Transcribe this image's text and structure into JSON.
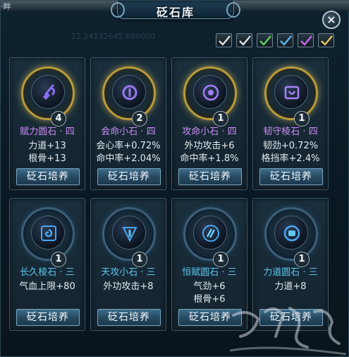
{
  "window": {
    "title": "砭石库",
    "top_left_fragment": "·畔",
    "faint_number": "21.24132645.680000",
    "close_label": "×"
  },
  "filters": [
    {
      "icon": "check-icon",
      "color": "#d8e0e4"
    },
    {
      "icon": "check-icon",
      "color": "#d8e0e4"
    },
    {
      "icon": "check-icon",
      "color": "#5fd35a"
    },
    {
      "icon": "check-icon",
      "color": "#5fb6ef"
    },
    {
      "icon": "check-icon",
      "color": "#c96af0"
    },
    {
      "icon": "check-icon",
      "color": "#e8c860"
    }
  ],
  "colors": {
    "purple_name": "#c98bf2",
    "blue_name": "#5fc6ef",
    "gold_ring": "#b89a3a"
  },
  "stones": [
    {
      "name": "赋力圆石 · 四",
      "count": "4",
      "attrs": [
        "力道+13",
        "根骨+13"
      ],
      "button": "砭石培养",
      "icon": "sword-rune-icon",
      "tier": "purple"
    },
    {
      "name": "会命小石 · 四",
      "count": "2",
      "attrs": [
        "会心率+0.72%",
        "命中率+2.04%"
      ],
      "button": "砭石培养",
      "icon": "circle-rune-icon",
      "tier": "purple"
    },
    {
      "name": "攻命小石 · 四",
      "count": "1",
      "attrs": [
        "外功攻击+6",
        "命中率+1.8%"
      ],
      "button": "砭石培养",
      "icon": "eye-rune-icon",
      "tier": "purple"
    },
    {
      "name": "韧守棱石 · 四",
      "count": "1",
      "attrs": [
        "韧劲+0.72%",
        "格挡率+2.4%"
      ],
      "button": "砭石培养",
      "icon": "shield-rune-icon",
      "tier": "purple"
    },
    {
      "name": "长久棱石 · 三",
      "count": "1",
      "attrs": [
        "气血上限+80",
        ""
      ],
      "button": "砭石培养",
      "icon": "swirl-rune-icon",
      "tier": "blue"
    },
    {
      "name": "天攻小石 · 三",
      "count": "1",
      "attrs": [
        "外功攻击+8",
        ""
      ],
      "button": "砭石培养",
      "icon": "blade-rune-icon",
      "tier": "blue"
    },
    {
      "name": "恒赋圆石 · 三",
      "count": "1",
      "attrs": [
        "气劲+6",
        "根骨+6"
      ],
      "button": "砭石培养",
      "icon": "slash-rune-icon",
      "tier": "blue"
    },
    {
      "name": "力道圆石 · 三",
      "count": "1",
      "attrs": [
        "力道+8",
        ""
      ],
      "button": "砭石培养",
      "icon": "fist-rune-icon",
      "tier": "blue"
    }
  ]
}
